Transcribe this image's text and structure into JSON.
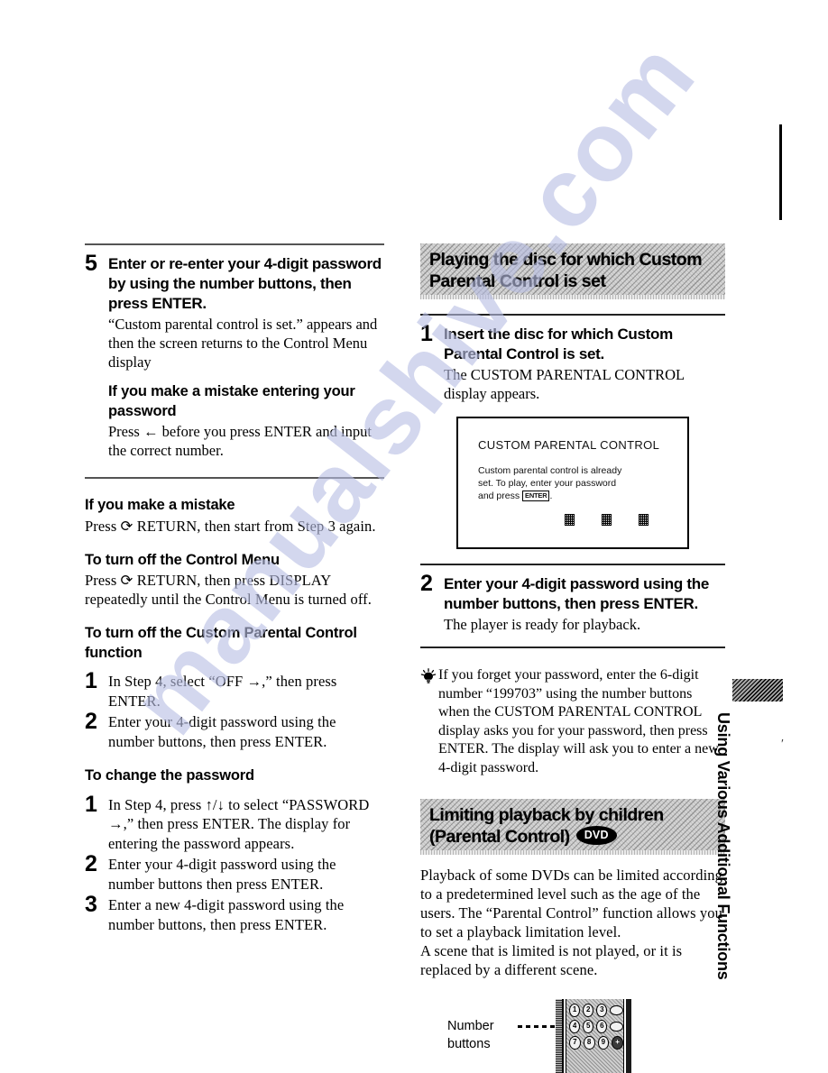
{
  "page": {
    "left_column": {
      "step5": {
        "number": "5",
        "heading": "Enter or re-enter your 4-digit password by using the number buttons, then press ENTER.",
        "body": "“Custom parental control is set.” appears and then the screen returns to the Control Menu display",
        "sub_heading": "If you make a mistake entering your password",
        "sub_body": "Press ← before you press ENTER and input the correct number."
      },
      "mistake": {
        "heading": "If you make a mistake",
        "body": "Press ⟳ RETURN, then start from Step 3 again."
      },
      "turn_off_menu": {
        "heading": "To turn off the Control Menu",
        "body": "Press ⟳ RETURN, then press DISPLAY repeatedly until the Control Menu is turned off."
      },
      "turn_off_cpc": {
        "heading": "To turn off the Custom Parental Control function",
        "steps": [
          {
            "number": "1",
            "text": "In Step 4, select “OFF →,” then press ENTER."
          },
          {
            "number": "2",
            "text": "Enter your 4-digit password using the number buttons, then press ENTER."
          }
        ]
      },
      "change_password": {
        "heading": "To change the password",
        "steps": [
          {
            "number": "1",
            "text": "In Step 4, press ↑/↓ to select “PASSWORD →,” then press ENTER. The display for entering the password appears."
          },
          {
            "number": "2",
            "text": "Enter your 4-digit password using the number buttons then press ENTER."
          },
          {
            "number": "3",
            "text": "Enter a new 4-digit password using the number buttons, then press ENTER."
          }
        ]
      }
    },
    "right_column": {
      "banner1": {
        "line1": "Playing the disc for which Custom",
        "line2": "Parental Control is set"
      },
      "step1": {
        "number": "1",
        "heading": "Insert the disc for which Custom Parental Control is set.",
        "body": "The CUSTOM PARENTAL CONTROL display appears."
      },
      "screen": {
        "title": "CUSTOM PARENTAL CONTROL",
        "line1": "Custom parental control is already",
        "line2": "set. To play, enter your password",
        "line3_pre": "and press ",
        "enter_key": "ENTER",
        "line3_post": ".",
        "dot_count": 3
      },
      "step2": {
        "number": "2",
        "heading": "Enter your 4-digit password using the number buttons, then press ENTER.",
        "body": "The player is ready for playback."
      },
      "tip": {
        "icon": "lightbulb-icon",
        "text": "If you forget your password, enter the 6-digit number “199703” using the number buttons when the CUSTOM PARENTAL CONTROL display asks you for your password, then press ENTER. The display will ask you to enter a new 4-digit password."
      },
      "banner2": {
        "line1": "Limiting playback by children",
        "line2": "(Parental Control)",
        "badge": "DVD"
      },
      "intro": {
        "para1": "Playback of some DVDs can be limited according to a predetermined level such as the age of the users. The “Parental Control” function allows you to set a playback limitation level.",
        "para2": "A scene that is limited is not played, or it is replaced by a different scene."
      },
      "remote": {
        "label_line1": "Number",
        "label_line2": "buttons",
        "keys": [
          [
            "1",
            "2",
            "3",
            ""
          ],
          [
            "4",
            "5",
            "6",
            ""
          ],
          [
            "7",
            "8",
            "9",
            "+"
          ]
        ]
      }
    },
    "side_tab": {
      "text": "Using Various Additional Functions"
    },
    "watermark": {
      "text": "manualshive.com"
    }
  }
}
